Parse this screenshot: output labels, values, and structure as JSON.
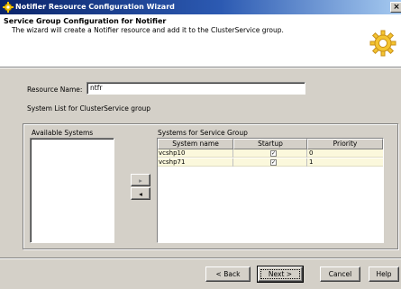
{
  "window": {
    "title": "Notifier Resource Configuration Wizard",
    "close_glyph": "×",
    "icon": "wizard-app-icon"
  },
  "header": {
    "title": "Service Group Configuration for Notifier",
    "description": "The wizard will create a Notifier resource and add it to the ClusterService group.",
    "icon": "gear-icon"
  },
  "form": {
    "resource_name_label": "Resource Name:",
    "resource_name_value": "ntfr",
    "system_list_label": "System List for ClusterService group"
  },
  "available_systems": {
    "label": "Available Systems",
    "items": []
  },
  "move_buttons": {
    "add_glyph": "▸",
    "remove_glyph": "◂"
  },
  "service_group_systems": {
    "label": "Systems for Service Group",
    "columns": [
      "System name",
      "Startup",
      "Priority"
    ],
    "rows": [
      {
        "system": "vcshp10",
        "startup": true,
        "priority": "0"
      },
      {
        "system": "vcshp71",
        "startup": true,
        "priority": "1"
      }
    ]
  },
  "footer": {
    "back_label": "< Back",
    "next_label": "Next >",
    "cancel_label": "Cancel",
    "help_label": "Help"
  },
  "colors": {
    "titlebar_start": "#0a246a",
    "titlebar_end": "#a6caf0",
    "dialog_bg": "#d4d0c8",
    "row_highlight": "#fbf8dc"
  }
}
